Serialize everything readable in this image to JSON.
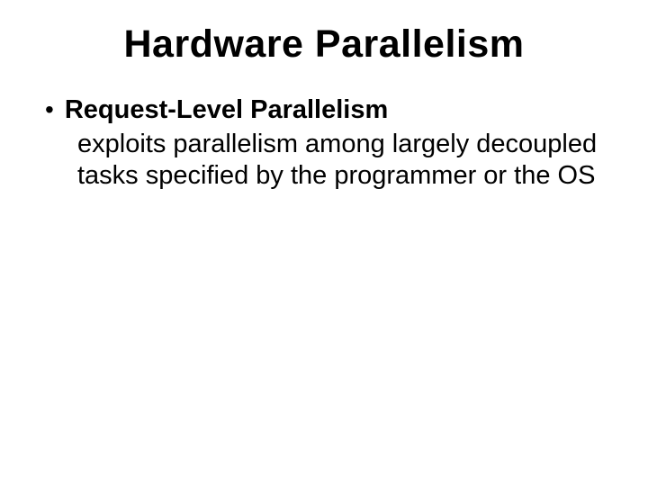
{
  "slide": {
    "title": "Hardware Parallelism",
    "bullet": {
      "heading": "Request-Level Parallelism",
      "description": "exploits parallelism among largely decoupled tasks specified by the programmer or the OS"
    }
  }
}
